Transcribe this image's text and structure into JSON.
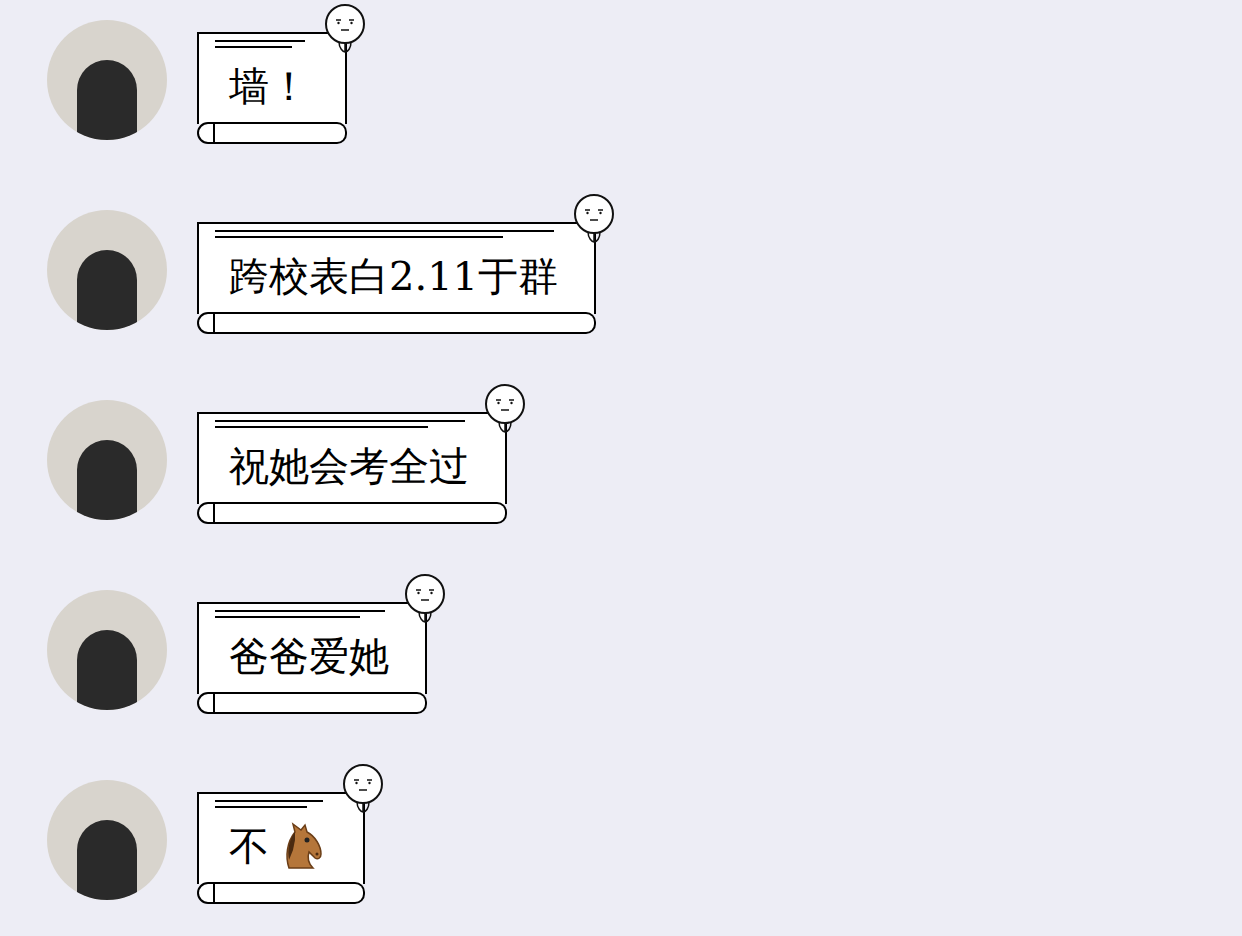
{
  "messages": [
    {
      "text": "墙！",
      "kind": "text"
    },
    {
      "text": "跨校表白2.11于群",
      "kind": "text"
    },
    {
      "text": "祝她会考全过",
      "kind": "text"
    },
    {
      "text": "爸爸爱她",
      "kind": "text"
    },
    {
      "text": "不",
      "kind": "text-with-horse"
    }
  ]
}
